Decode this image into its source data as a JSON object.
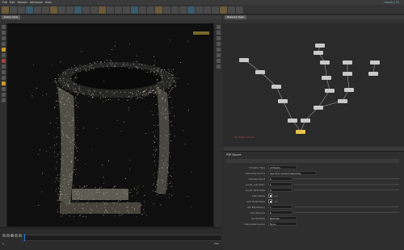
{
  "app": {
    "title": "Houdini FX"
  },
  "menu": [
    "File",
    "Edit",
    "Render",
    "Windows",
    "Help"
  ],
  "scene_view": {
    "tab_label": "Scene View"
  },
  "network_view": {
    "tab_label": "Network View"
  },
  "params": {
    "node_label": "POP Source",
    "rows": [
      {
        "label": "Emission Type",
        "value": "All Points"
      },
      {
        "label": "Geometry Source",
        "value": "Use First Context Geometry"
      },
      {
        "label": "Impulse Count",
        "value": "0"
      },
      {
        "label": "Const. Activation",
        "value": "1"
      },
      {
        "label": "Const. Birth Rate",
        "value": "0"
      },
      {
        "label": "Jitter Births",
        "value": "on"
      },
      {
        "label": "Add ID Attribute",
        "value": "on"
      },
      {
        "label": "Life Expectancy",
        "value": "1"
      },
      {
        "label": "Life Variance",
        "value": "0"
      },
      {
        "label": "Guide Mode",
        "value": "Particles"
      },
      {
        "label": "Interpolate Source",
        "value": "None"
      }
    ]
  },
  "timeline": {
    "start": "1",
    "end": "240",
    "current": "1"
  },
  "status": {
    "network_note": "Sim Points 172 v/v"
  }
}
